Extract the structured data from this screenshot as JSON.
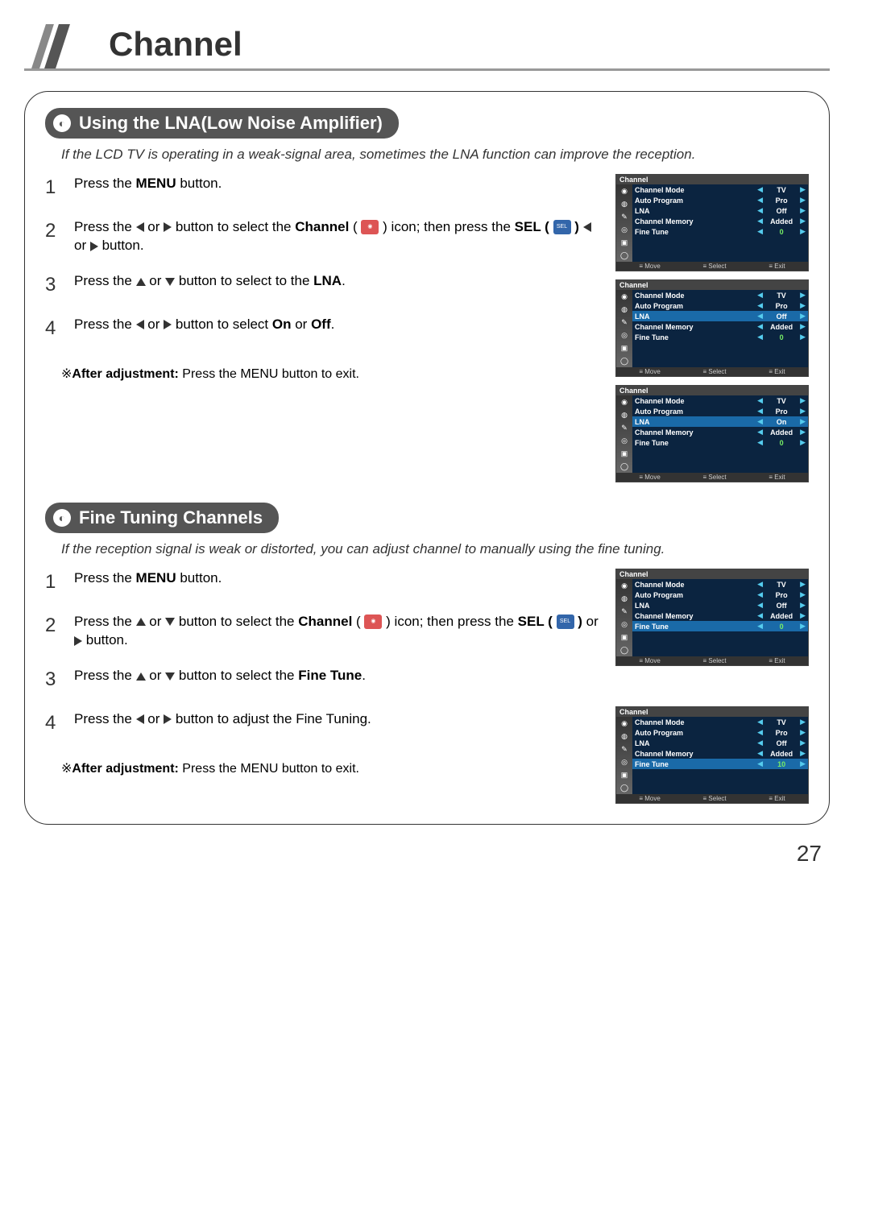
{
  "page_title": "Channel",
  "page_number": "27",
  "section1": {
    "heading": "Using the LNA(Low Noise Amplifier)",
    "desc": "If the LCD TV is operating in a weak-signal area, sometimes the LNA function can improve the reception.",
    "steps": {
      "s1": "Press the MENU button.",
      "s2a": "Press the ",
      "s2b": " or ",
      "s2c": " button to select the Channel ( ",
      "s2d": " ) icon; then press the SEL ( ",
      "s2e": " ) ",
      "s2f": " or ",
      "s2g": " button.",
      "s3a": "Press the ",
      "s3b": " or ",
      "s3c": " button to select to the LNA.",
      "s4a": "Press the ",
      "s4b": " or ",
      "s4c": " button to select On or Off."
    },
    "footer": "※After adjustment: Press the MENU button to exit."
  },
  "section2": {
    "heading": "Fine Tuning Channels",
    "desc": "If the reception signal is weak or distorted, you can adjust channel to manually using the fine tuning.",
    "steps": {
      "s1": "Press the MENU button.",
      "s2a": "Press the ",
      "s2b": " or ",
      "s2c": " button to select the Channel ( ",
      "s2d": " ) icon; then press the SEL ( ",
      "s2e": " ) or ",
      "s2f": " button.",
      "s3a": "Press the ",
      "s3b": " or ",
      "s3c": " button to select the Fine Tune.",
      "s4a": "Press the ",
      "s4b": " or ",
      "s4c": " button to adjust the Fine Tuning."
    },
    "footer": "※After adjustment: Press the MENU button to exit."
  },
  "osd": {
    "title": "Channel",
    "rows": {
      "mode": "Channel Mode",
      "auto": "Auto Program",
      "lna": "LNA",
      "mem": "Channel Memory",
      "fine": "Fine Tune"
    },
    "vals": {
      "tv": "TV",
      "pro": "Pro",
      "off": "Off",
      "on": "On",
      "added": "Added",
      "zero": "0",
      "ten": "10"
    },
    "foot": {
      "move": "Move",
      "select": "Select",
      "exit": "Exit"
    }
  }
}
